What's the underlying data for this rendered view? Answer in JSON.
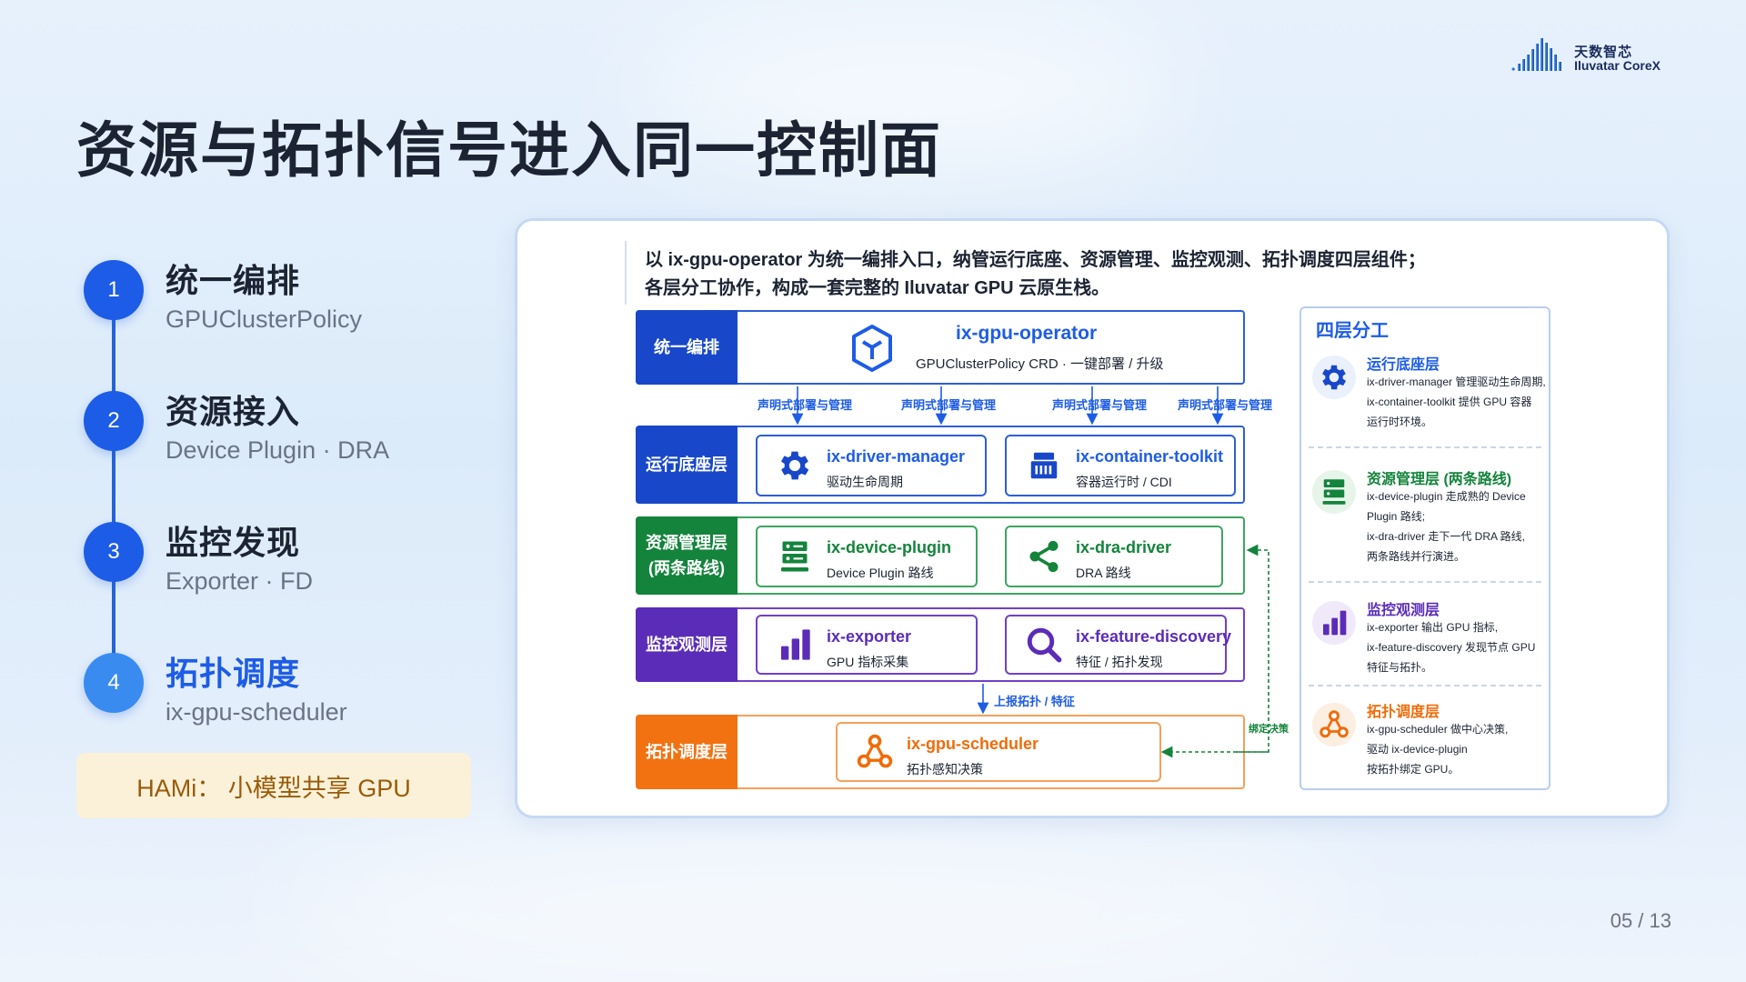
{
  "slide": {
    "title": "资源与拓扑信号进入同一控制面",
    "page": "05 / 13",
    "logo": {
      "cn": "天数智芯",
      "en": "Iluvatar CoreX"
    }
  },
  "steps": [
    {
      "num": "1",
      "title": "统一编排",
      "sub": "GPUClusterPolicy"
    },
    {
      "num": "2",
      "title": "资源接入",
      "sub": "Device Plugin · DRA"
    },
    {
      "num": "3",
      "title": "监控发现",
      "sub": "Exporter · FD"
    },
    {
      "num": "4",
      "title": "拓扑调度",
      "sub": "ix-gpu-scheduler"
    }
  ],
  "hami": "HAMi： 小模型共享 GPU",
  "diagram": {
    "intro_line1": "以 ix-gpu-operator 为统一编排入口，纳管运行底座、资源管理、监控观测、拓扑调度四层组件；",
    "intro_line2": "各层分工协作，构成一套完整的 Iluvatar GPU 云原生栈。",
    "layers": {
      "orchestration": {
        "label": "统一编排",
        "node": {
          "name": "ix-gpu-operator",
          "desc": "GPUClusterPolicy CRD · 一键部署 / 升级"
        }
      },
      "runtime": {
        "label": "运行底座层",
        "nodes": [
          {
            "name": "ix-driver-manager",
            "desc": "驱动生命周期",
            "icon": "gear-icon"
          },
          {
            "name": "ix-container-toolkit",
            "desc": "容器运行时 / CDI",
            "icon": "container-icon"
          }
        ]
      },
      "resource": {
        "label_line1": "资源管理层",
        "label_line2": "(两条路线)",
        "nodes": [
          {
            "name": "ix-device-plugin",
            "desc": "Device Plugin 路线",
            "icon": "server-icon"
          },
          {
            "name": "ix-dra-driver",
            "desc": "DRA 路线",
            "icon": "share-icon"
          }
        ]
      },
      "monitor": {
        "label": "监控观测层",
        "nodes": [
          {
            "name": "ix-exporter",
            "desc": "GPU 指标采集",
            "icon": "bar-chart-icon"
          },
          {
            "name": "ix-feature-discovery",
            "desc": "特征 / 拓扑发现",
            "icon": "search-icon"
          }
        ]
      },
      "scheduling": {
        "label": "拓扑调度层",
        "node": {
          "name": "ix-gpu-scheduler",
          "desc": "拓扑感知决策",
          "icon": "topology-icon"
        }
      }
    },
    "edge_labels": {
      "declare": [
        "声明式部署与管理",
        "声明式部署与管理",
        "声明式部署与管理",
        "声明式部署与管理"
      ],
      "report": "上报拓扑 / 特征",
      "bind": "绑定决策"
    },
    "panel": {
      "title": "四层分工",
      "sections": [
        {
          "heading": "运行底座层",
          "icon": "gear-icon",
          "color": "#1d5ce6",
          "lines": [
            "ix-driver-manager 管理驱动生命周期,",
            "ix-container-toolkit 提供 GPU 容器",
            "运行时环境。"
          ]
        },
        {
          "heading": "资源管理层 (两条路线)",
          "icon": "server-icon",
          "color": "#14843c",
          "lines": [
            "ix-device-plugin 走成熟的 Device",
            "Plugin 路线;",
            "ix-dra-driver 走下一代 DRA 路线,",
            "两条路线并行演进。"
          ]
        },
        {
          "heading": "监控观测层",
          "icon": "bar-chart-icon",
          "color": "#5b2cb8",
          "lines": [
            "ix-exporter 输出 GPU 指标,",
            "ix-feature-discovery 发现节点 GPU",
            "特征与拓扑。"
          ]
        },
        {
          "heading": "拓扑调度层",
          "icon": "topology-icon",
          "color": "#ef6c0a",
          "lines": [
            "ix-gpu-scheduler 做中心决策,",
            "驱动 ix-device-plugin",
            "按拓扑绑定 GPU。"
          ]
        }
      ]
    }
  }
}
